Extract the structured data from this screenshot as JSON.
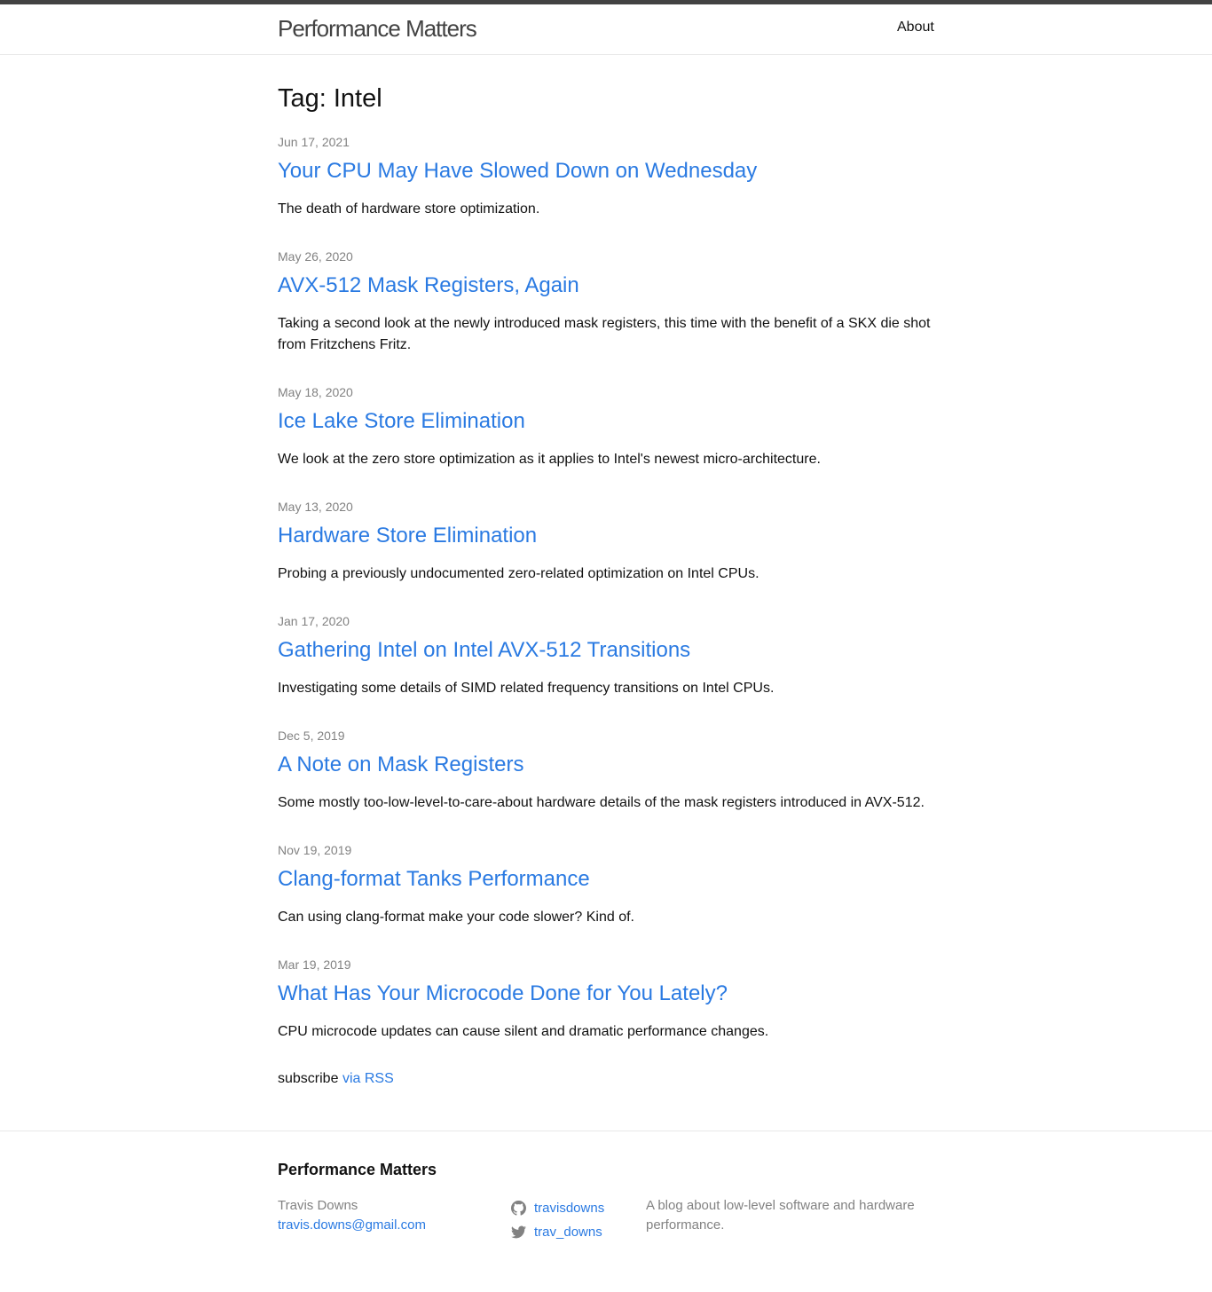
{
  "header": {
    "site_title": "Performance Matters",
    "nav": {
      "about": "About"
    }
  },
  "page": {
    "heading": "Tag: Intel"
  },
  "posts": [
    {
      "date": "Jun 17, 2021",
      "title": "Your CPU May Have Slowed Down on Wednesday",
      "excerpt": "The death of hardware store optimization."
    },
    {
      "date": "May 26, 2020",
      "title": "AVX-512 Mask Registers, Again",
      "excerpt": "Taking a second look at the newly introduced mask registers, this time with the benefit of a SKX die shot from Fritzchens Fritz."
    },
    {
      "date": "May 18, 2020",
      "title": "Ice Lake Store Elimination",
      "excerpt": "We look at the zero store optimization as it applies to Intel's newest micro-architecture."
    },
    {
      "date": "May 13, 2020",
      "title": "Hardware Store Elimination",
      "excerpt": "Probing a previously undocumented zero-related optimization on Intel CPUs."
    },
    {
      "date": "Jan 17, 2020",
      "title": "Gathering Intel on Intel AVX-512 Transitions",
      "excerpt": "Investigating some details of SIMD related frequency transitions on Intel CPUs."
    },
    {
      "date": "Dec 5, 2019",
      "title": "A Note on Mask Registers",
      "excerpt": "Some mostly too-low-level-to-care-about hardware details of the mask registers introduced in AVX-512."
    },
    {
      "date": "Nov 19, 2019",
      "title": "Clang-format Tanks Performance",
      "excerpt": "Can using clang-format make your code slower? Kind of."
    },
    {
      "date": "Mar 19, 2019",
      "title": "What Has Your Microcode Done for You Lately?",
      "excerpt": "CPU microcode updates can cause silent and dramatic performance changes."
    }
  ],
  "subscribe": {
    "prefix": "subscribe",
    "link": "via RSS"
  },
  "footer": {
    "heading": "Performance Matters",
    "author_name": "Travis Downs",
    "author_email": "travis.downs@gmail.com",
    "github": {
      "icon": "github-icon",
      "username": "travisdowns"
    },
    "twitter": {
      "icon": "twitter-icon",
      "username": "trav_downs"
    },
    "description": "A blog about low-level software and hardware performance."
  },
  "colors": {
    "link": "#2a7ae2",
    "meta": "#828282",
    "header_border": "#424242"
  }
}
